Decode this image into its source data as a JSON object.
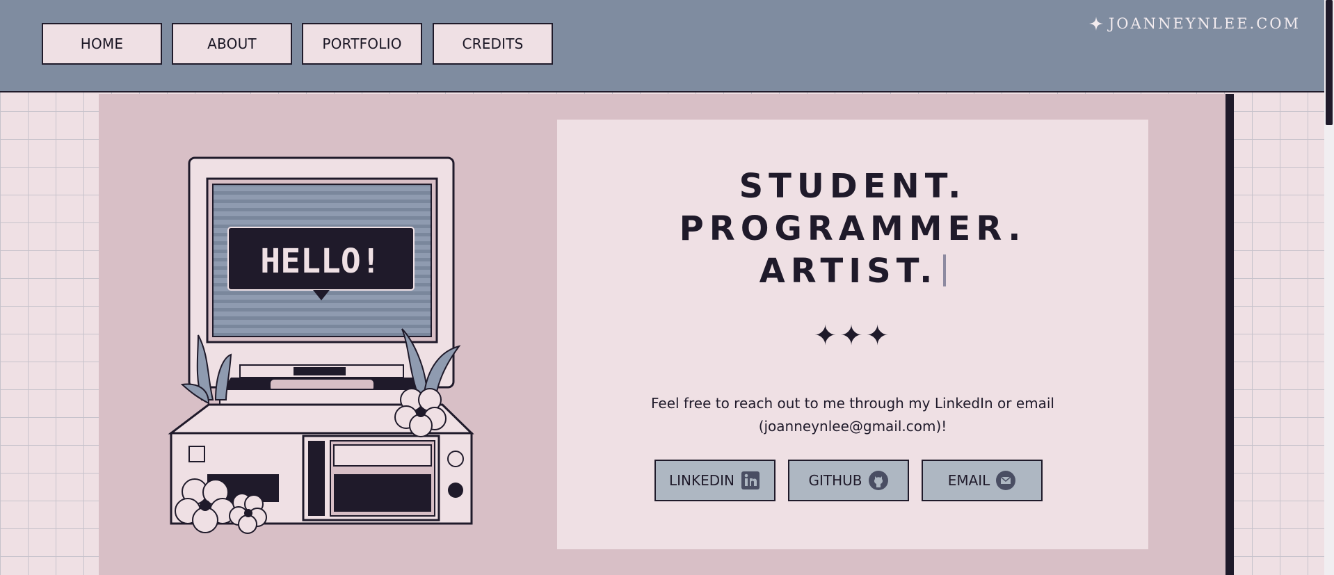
{
  "nav": {
    "items": [
      {
        "label": "HOME"
      },
      {
        "label": "ABOUT"
      },
      {
        "label": "PORTFOLIO"
      },
      {
        "label": "CREDITS"
      }
    ]
  },
  "site": {
    "name": "JOANNEYNLEE.COM",
    "icon": "sparkle-icon"
  },
  "hero": {
    "illustration_text": "HELLO!",
    "headline": [
      "STUDENT.",
      "PROGRAMMER.",
      "ARTIST."
    ],
    "stars": "✦✦✦",
    "blurb_line1": "Feel free to reach out to me through my LinkedIn or email",
    "blurb_line2": "(joanneynlee@gmail.com)!",
    "buttons": [
      {
        "label": "LINKEDIN",
        "icon": "linkedin-icon"
      },
      {
        "label": "GITHUB",
        "icon": "github-icon"
      },
      {
        "label": "EMAIL",
        "icon": "mail-icon"
      }
    ]
  },
  "colors": {
    "header": "#7f8ca0",
    "page_bg": "#efe0e4",
    "main_bg": "#d8bfc6",
    "ink": "#1f1a2a",
    "button_bg": "#aeb7c2"
  }
}
